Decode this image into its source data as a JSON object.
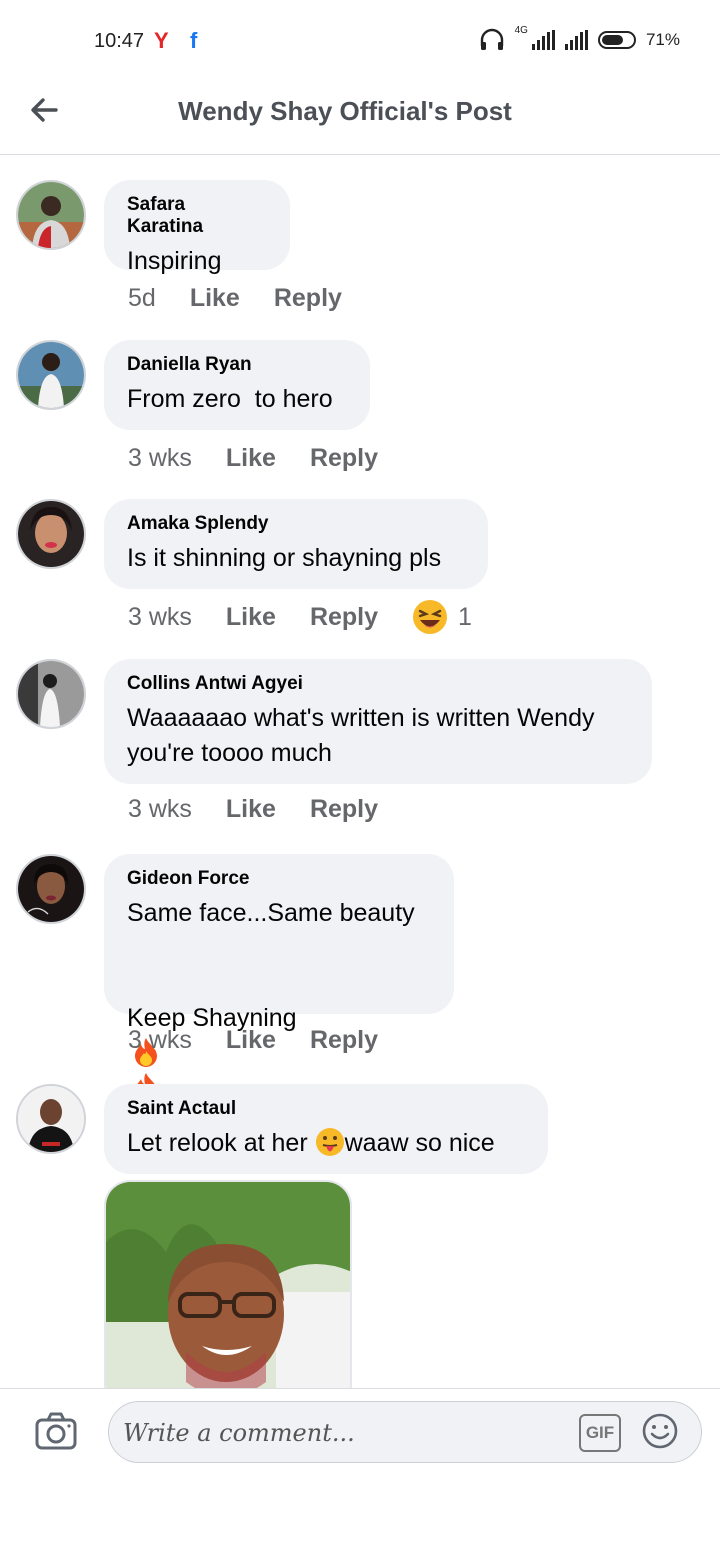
{
  "status_bar": {
    "time": "10:47",
    "network": "4G",
    "battery": "71%",
    "battery_level": 0.71
  },
  "header": {
    "title": "Wendy Shay Official's Post"
  },
  "comments": [
    {
      "author": "Safara Karatina",
      "text": "Inspiring",
      "age": "5d",
      "like": "Like",
      "reply": "Reply"
    },
    {
      "author": "Daniella Ryan",
      "text": "From zero  to hero",
      "age": "3 wks",
      "like": "Like",
      "reply": "Reply"
    },
    {
      "author": "Amaka Splendy",
      "text": "Is it shinning or shayning pls",
      "age": "3 wks",
      "like": "Like",
      "reply": "Reply",
      "reaction_count": "1"
    },
    {
      "author": "Collins Antwi Agyei",
      "text": "Waaaaaao what's written is written Wendy you're toooo much",
      "age": "3 wks",
      "like": "Like",
      "reply": "Reply"
    },
    {
      "author": "Gideon Force",
      "text_line1": "Same face...Same beauty",
      "text_line2": "Keep Shayning",
      "age": "3 wks",
      "like": "Like",
      "reply": "Reply"
    },
    {
      "author": "Saint Actaul",
      "text_before": "Let relook at her ",
      "text_after": "waaw so nice"
    }
  ],
  "composer": {
    "placeholder": "Write a comment...",
    "gif_label": "GIF"
  },
  "colors": {
    "bubble": "#f0f2f5",
    "meta_text": "#65676b",
    "title_text": "#4b4f56"
  }
}
